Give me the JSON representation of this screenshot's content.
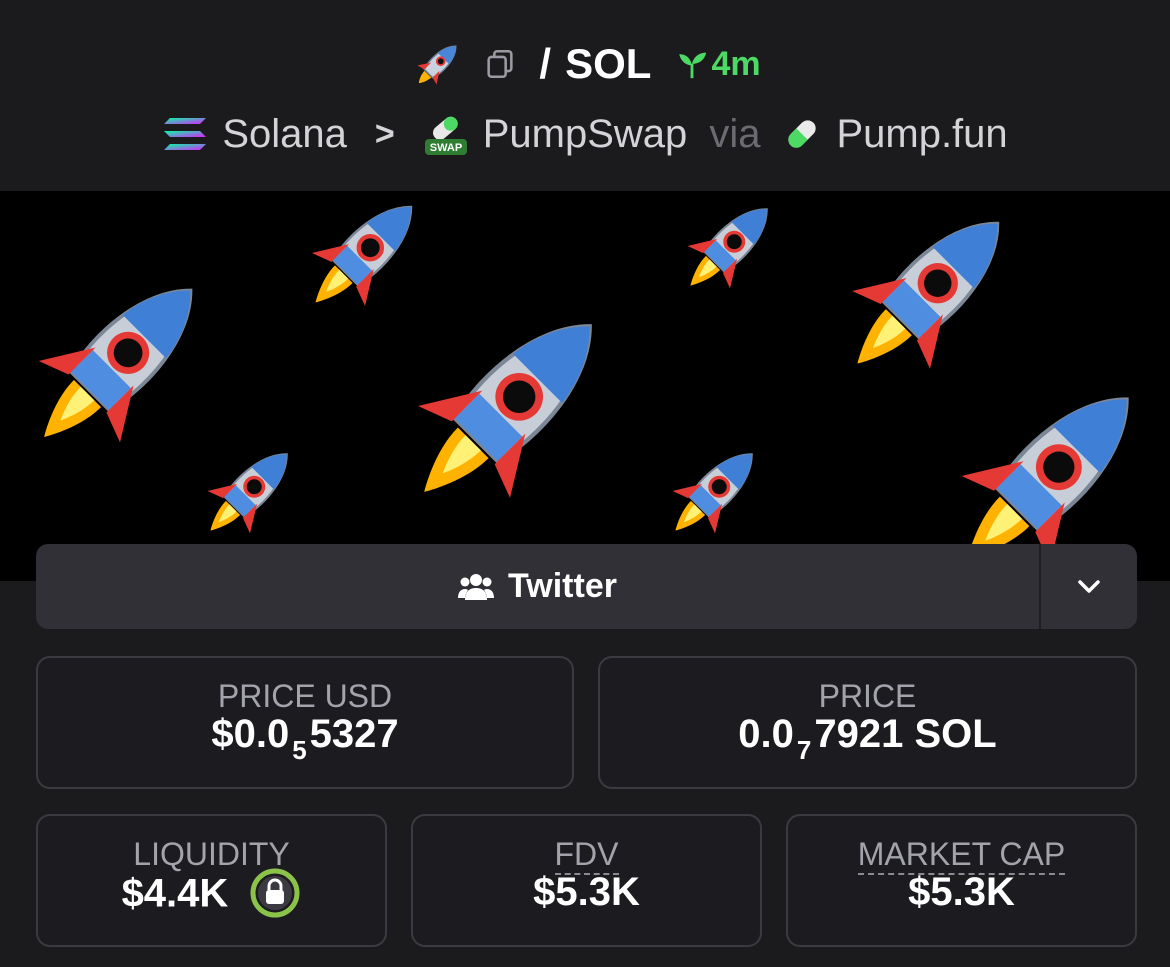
{
  "header": {
    "token_icon": "rocket-emoji-icon",
    "copy_icon": "copy-icon",
    "slash": "/",
    "quote_symbol": "SOL",
    "age": "4m",
    "age_icon": "sprout-icon",
    "age_color": "#4cd964"
  },
  "breadcrumb": {
    "chain": "Solana",
    "chain_icon": "solana-icon",
    "separator": ">",
    "dex": "PumpSwap",
    "dex_icon": "swap-icon",
    "via_label": "via",
    "launchpad": "Pump.fun",
    "launchpad_icon": "pill-icon"
  },
  "banner": {
    "image": "rocket-pattern-banner"
  },
  "social": {
    "label": "Twitter",
    "icon": "people-icon",
    "toggle_icon": "chevron-down-icon"
  },
  "stats": {
    "price_usd": {
      "label": "PRICE USD",
      "prefix": "$0.0",
      "zeros": "5",
      "digits": "5327"
    },
    "price": {
      "label": "PRICE",
      "prefix": "0.0",
      "zeros": "7",
      "digits": "7921 SOL"
    },
    "liquidity": {
      "label": "LIQUIDITY",
      "value": "$4.4K",
      "icon": "lock-icon",
      "icon_color": "#8bc34a"
    },
    "fdv": {
      "label": "FDV",
      "value": "$5.3K"
    },
    "market_cap": {
      "label": "MARKET CAP",
      "value": "$5.3K"
    }
  }
}
